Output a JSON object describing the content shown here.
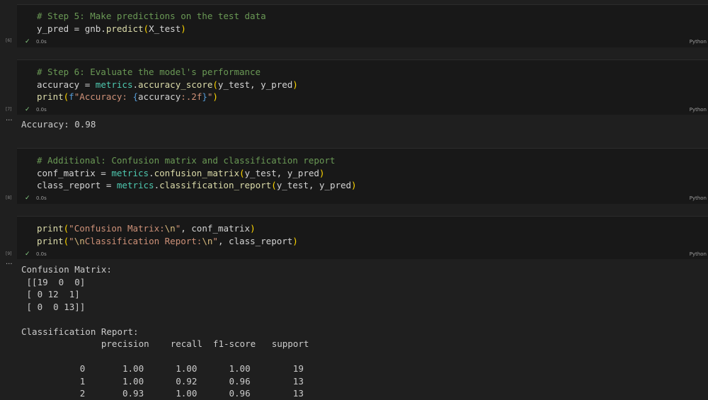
{
  "cells": [
    {
      "exec": "[6]",
      "time": "0.0s",
      "lang": "Python",
      "lines": [
        [
          {
            "t": "# Step 5: Make predictions on the test data",
            "c": "cm"
          }
        ],
        [
          {
            "t": "y_pred = gnb.",
            "c": "txt"
          },
          {
            "t": "predict",
            "c": "fn"
          },
          {
            "t": "(",
            "c": "br1"
          },
          {
            "t": "X_test",
            "c": "txt"
          },
          {
            "t": ")",
            "c": "br1"
          }
        ]
      ]
    },
    {
      "exec": "[7]",
      "time": "0.0s",
      "lang": "Python",
      "lines": [
        [
          {
            "t": "# Step 6: Evaluate the model's performance",
            "c": "cm"
          }
        ],
        [
          {
            "t": "accuracy = ",
            "c": "txt"
          },
          {
            "t": "metrics",
            "c": "mod"
          },
          {
            "t": ".",
            "c": "txt"
          },
          {
            "t": "accuracy_score",
            "c": "fn"
          },
          {
            "t": "(",
            "c": "br1"
          },
          {
            "t": "y_test, y_pred",
            "c": "txt"
          },
          {
            "t": ")",
            "c": "br1"
          }
        ],
        [
          {
            "t": "print",
            "c": "fn"
          },
          {
            "t": "(",
            "c": "br1"
          },
          {
            "t": "f",
            "c": "kw"
          },
          {
            "t": "\"Accuracy: ",
            "c": "str"
          },
          {
            "t": "{",
            "c": "kw"
          },
          {
            "t": "accuracy",
            "c": "txt"
          },
          {
            "t": ":.2f",
            "c": "str"
          },
          {
            "t": "}",
            "c": "kw"
          },
          {
            "t": "\"",
            "c": "str"
          },
          {
            "t": ")",
            "c": "br1"
          }
        ]
      ],
      "output": [
        "Accuracy: 0.98"
      ]
    },
    {
      "exec": "[8]",
      "time": "0.0s",
      "lang": "Python",
      "lines": [
        [
          {
            "t": "# Additional: Confusion matrix and classification report",
            "c": "cm"
          }
        ],
        [
          {
            "t": "conf_matrix = ",
            "c": "txt"
          },
          {
            "t": "metrics",
            "c": "mod"
          },
          {
            "t": ".",
            "c": "txt"
          },
          {
            "t": "confusion_matrix",
            "c": "fn"
          },
          {
            "t": "(",
            "c": "br1"
          },
          {
            "t": "y_test, y_pred",
            "c": "txt"
          },
          {
            "t": ")",
            "c": "br1"
          }
        ],
        [
          {
            "t": "class_report = ",
            "c": "txt"
          },
          {
            "t": "metrics",
            "c": "mod"
          },
          {
            "t": ".",
            "c": "txt"
          },
          {
            "t": "classification_report",
            "c": "fn"
          },
          {
            "t": "(",
            "c": "br1"
          },
          {
            "t": "y_test, y_pred",
            "c": "txt"
          },
          {
            "t": ")",
            "c": "br1"
          }
        ]
      ]
    },
    {
      "exec": "[9]",
      "time": "0.0s",
      "lang": "Python",
      "lines": [
        [
          {
            "t": "print",
            "c": "fn"
          },
          {
            "t": "(",
            "c": "br1"
          },
          {
            "t": "\"Confusion Matrix:",
            "c": "str"
          },
          {
            "t": "\\n",
            "c": "esc"
          },
          {
            "t": "\"",
            "c": "str"
          },
          {
            "t": ", conf_matrix",
            "c": "txt"
          },
          {
            "t": ")",
            "c": "br1"
          }
        ],
        [
          {
            "t": "print",
            "c": "fn"
          },
          {
            "t": "(",
            "c": "br1"
          },
          {
            "t": "\"",
            "c": "str"
          },
          {
            "t": "\\n",
            "c": "esc"
          },
          {
            "t": "Classification Report:",
            "c": "str"
          },
          {
            "t": "\\n",
            "c": "esc"
          },
          {
            "t": "\"",
            "c": "str"
          },
          {
            "t": ", class_report",
            "c": "txt"
          },
          {
            "t": ")",
            "c": "br1"
          }
        ]
      ],
      "output": [
        "Confusion Matrix:",
        " [[19  0  0]",
        " [ 0 12  1]",
        " [ 0  0 13]]",
        "",
        "Classification Report:",
        "               precision    recall  f1-score   support",
        "",
        "           0       1.00      1.00      1.00        19",
        "           1       1.00      0.92      0.96        13",
        "           2       0.93      1.00      0.96        13"
      ]
    }
  ],
  "output_marker": "···"
}
